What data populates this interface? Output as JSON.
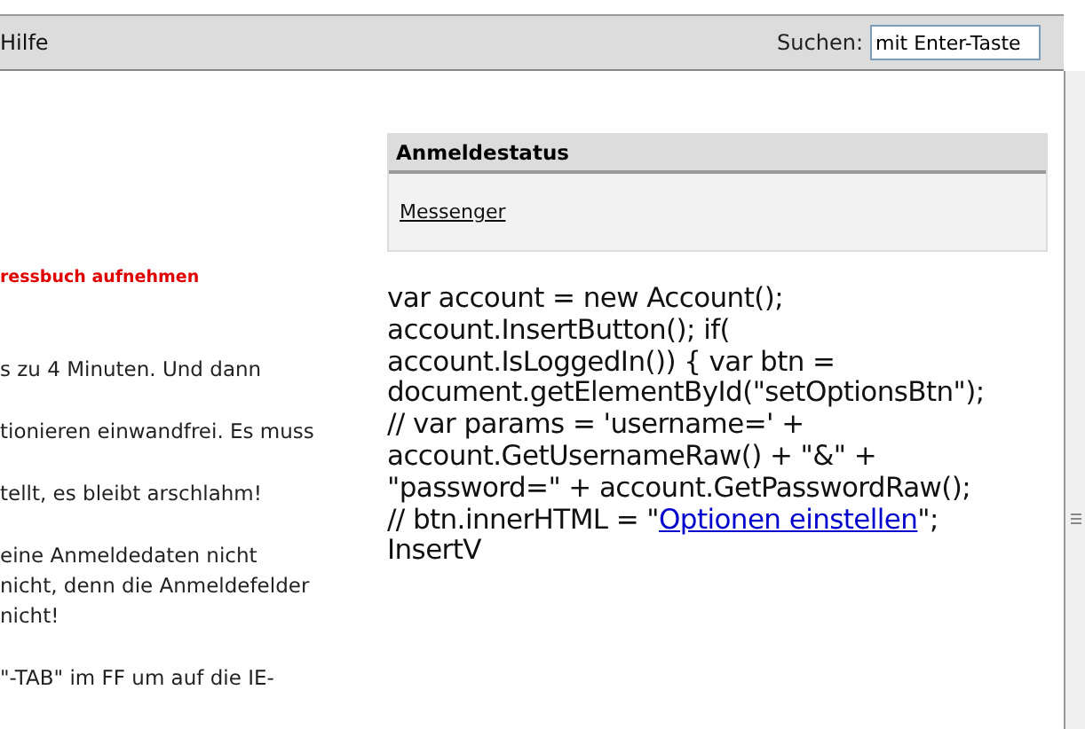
{
  "toolbar": {
    "menu_item": "Hilfe",
    "search_label": "Suchen:",
    "search_value": "mit Enter-Taste"
  },
  "left_column": {
    "heading": "ressbuch aufnehmen",
    "paragraphs": [
      [
        "s zu 4 Minuten. Und dann"
      ],
      [
        "tionieren einwandfrei. Es muss"
      ],
      [
        "tellt, es bleibt arschlahm!"
      ],
      [
        "eine Anmeldedaten nicht",
        "nicht, denn die Anmeldefelder",
        "nicht!"
      ],
      [
        "\"-TAB\" im FF um auf die IE-"
      ]
    ]
  },
  "status_box": {
    "title": "Anmeldestatus",
    "link": "Messenger"
  },
  "code": {
    "lines": [
      {
        "kind": "text",
        "text": "var account = new Account();"
      },
      {
        "kind": "text",
        "text": "account.InsertButton(); if("
      },
      {
        "kind": "text",
        "text": "account.IsLoggedIn()) { var btn ="
      },
      {
        "kind": "text",
        "text": "document.getElementById(\"setOptionsBtn\");"
      },
      {
        "kind": "text",
        "text": "// var params = 'username=' +"
      },
      {
        "kind": "text",
        "text": "account.GetUsernameRaw() + \"&\" +"
      },
      {
        "kind": "text",
        "text": "\"password=\" + account.GetPasswordRaw();"
      },
      {
        "kind": "link",
        "before": "// btn.innerHTML = \"",
        "link": "Optionen einstellen",
        "after": "\";"
      },
      {
        "kind": "text",
        "text": "InsertV"
      }
    ]
  }
}
